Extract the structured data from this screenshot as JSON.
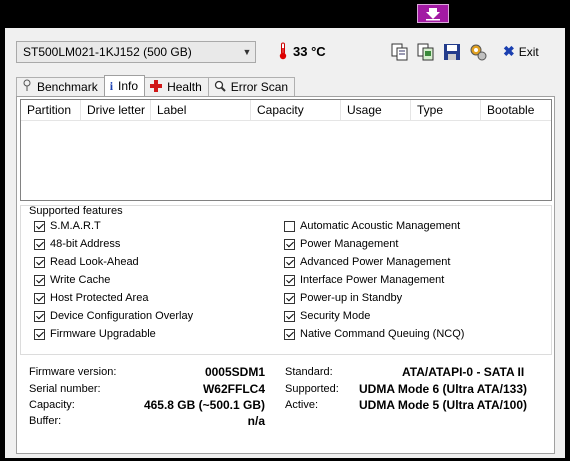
{
  "toolbar": {
    "drive": "ST500LM021-1KJ152 (500 GB)",
    "temperature": "33 °C",
    "exit_label": "Exit",
    "icons": [
      "copy-icon",
      "copy-screenshot-icon",
      "save-icon",
      "options-icon"
    ]
  },
  "tabs": [
    {
      "label": "Benchmark",
      "icon": "benchmark-icon"
    },
    {
      "label": "Info",
      "icon": "info-icon"
    },
    {
      "label": "Health",
      "icon": "health-icon"
    },
    {
      "label": "Error Scan",
      "icon": "magnifier-icon"
    }
  ],
  "partition_table": {
    "headers": [
      "Partition",
      "Drive letter",
      "Label",
      "Capacity",
      "Usage",
      "Type",
      "Bootable"
    ]
  },
  "features": {
    "title": "Supported features",
    "left": [
      {
        "label": "S.M.A.R.T",
        "checked": true
      },
      {
        "label": "48-bit Address",
        "checked": true
      },
      {
        "label": "Read Look-Ahead",
        "checked": true
      },
      {
        "label": "Write Cache",
        "checked": true
      },
      {
        "label": "Host Protected Area",
        "checked": true
      },
      {
        "label": "Device Configuration Overlay",
        "checked": true
      },
      {
        "label": "Firmware Upgradable",
        "checked": true
      }
    ],
    "right": [
      {
        "label": "Automatic Acoustic Management",
        "checked": false
      },
      {
        "label": "Power Management",
        "checked": true
      },
      {
        "label": "Advanced Power Management",
        "checked": true
      },
      {
        "label": "Interface Power Management",
        "checked": true
      },
      {
        "label": "Power-up in Standby",
        "checked": true
      },
      {
        "label": "Security Mode",
        "checked": true
      },
      {
        "label": "Native Command Queuing (NCQ)",
        "checked": true
      }
    ]
  },
  "info": {
    "firmware_label": "Firmware version:",
    "firmware": "0005SDM1",
    "serial_label": "Serial number:",
    "serial": "W62FFLC4",
    "capacity_label": "Capacity:",
    "capacity": "465.8 GB (~500.1 GB)",
    "buffer_label": "Buffer:",
    "buffer": "n/a",
    "standard_label": "Standard:",
    "standard": "ATA/ATAPI-0 - SATA II",
    "supported_label": "Supported:",
    "supported": "UDMA Mode 6 (Ultra ATA/133)",
    "active_label": "Active:",
    "active": "UDMA Mode 5 (Ultra ATA/100)"
  }
}
